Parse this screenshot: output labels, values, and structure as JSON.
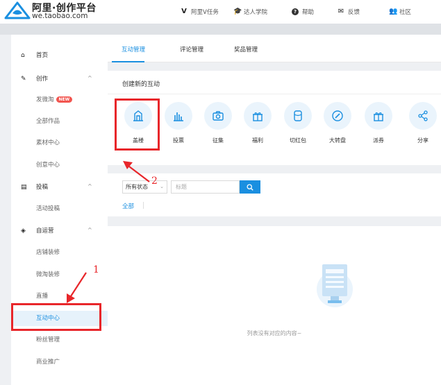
{
  "header": {
    "brand": "阿里·创作平台",
    "domain": "we.taobao.com",
    "nav": [
      {
        "icon": "v-icon",
        "glyph": "V",
        "label": "阿里V任务"
      },
      {
        "icon": "graduation-cap-icon",
        "glyph": "🎓",
        "label": "达人学院"
      },
      {
        "icon": "help-icon",
        "glyph": "?",
        "label": "帮助"
      },
      {
        "icon": "feedback-icon",
        "glyph": "✉",
        "label": "反馈"
      },
      {
        "icon": "community-icon",
        "glyph": "👥",
        "label": "社区"
      }
    ]
  },
  "sidebar": {
    "home": {
      "label": "首页",
      "icon": "home-icon",
      "glyph": "⌂"
    },
    "create": {
      "label": "创作",
      "icon": "pen-icon",
      "glyph": "✎",
      "chevron": "^",
      "items": [
        {
          "label": "发微淘",
          "badge": "NEW"
        },
        {
          "label": "全部作品"
        },
        {
          "label": "素材中心"
        },
        {
          "label": "创意中心"
        }
      ]
    },
    "submit": {
      "label": "投稿",
      "icon": "document-icon",
      "glyph": "▤",
      "chevron": "^",
      "items": [
        {
          "label": "活动投稿"
        }
      ]
    },
    "self_operated": {
      "label": "自运营",
      "icon": "cube-icon",
      "glyph": "◈",
      "chevron": "^",
      "items": [
        {
          "label": "店铺装修"
        },
        {
          "label": "微淘装修"
        },
        {
          "label": "直播"
        },
        {
          "label": "互动中心",
          "active": true
        },
        {
          "label": "粉丝管理"
        },
        {
          "label": "商业推广"
        }
      ]
    }
  },
  "tabs": [
    {
      "label": "互动管理",
      "active": true
    },
    {
      "label": "评论管理"
    },
    {
      "label": "奖品管理"
    }
  ],
  "create_section": {
    "title": "创建新的互动",
    "options": [
      {
        "label": "盖楼",
        "icon": "building-icon"
      },
      {
        "label": "投票",
        "icon": "vote-chart-icon"
      },
      {
        "label": "征集",
        "icon": "camera-icon"
      },
      {
        "label": "福利",
        "icon": "gift-icon"
      },
      {
        "label": "切红包",
        "icon": "red-packet-icon"
      },
      {
        "label": "大转盘",
        "icon": "wheel-icon"
      },
      {
        "label": "派券",
        "icon": "coupon-icon"
      },
      {
        "label": "分享",
        "icon": "share-icon"
      }
    ]
  },
  "filter": {
    "status_value": "所有状态",
    "search_placeholder": "标题",
    "all_link": "全部"
  },
  "empty": {
    "text": "列表没有对应的内容~"
  },
  "annotations": {
    "label_1": "1",
    "label_2": "2",
    "color": "#e8262a"
  },
  "colors": {
    "accent": "#1a8fe0",
    "badge": "#f2554f",
    "icon_bg": "#eaf4fc"
  }
}
